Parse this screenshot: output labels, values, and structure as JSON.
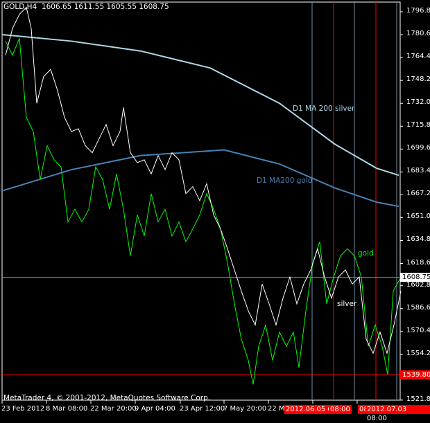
{
  "header": {
    "symbol": "GOLD,H4",
    "open": "1606.65",
    "high": "1611.55",
    "low": "1605.55",
    "close": "1608.75"
  },
  "copyright": "MetaTrader 4, © 2001-2012, MetaQuotes Software Corp.",
  "price_axis": [
    "1796.80",
    "1780.60",
    "1764.40",
    "1748.20",
    "1732.00",
    "1715.80",
    "1699.60",
    "1683.40",
    "1667.20",
    "1651.00",
    "1634.80",
    "1618.60",
    "1602.85",
    "1586.65",
    "1570.45",
    "1554.25",
    "1538.05",
    "1521.85"
  ],
  "price_tags": {
    "current": "1608.75",
    "line": "1539.80"
  },
  "date_axis": [
    "23 Feb 2012",
    "8 Mar 08:00",
    "22 Mar 20:00",
    "9 Apr 04:00",
    "23 Apr 12:00",
    "7 May 20:00",
    "22 Ma"
  ],
  "vline_labels": [
    "2012.06.05 08:00",
    "08:00",
    "08",
    "2012.07.03 08:00"
  ],
  "annotations": {
    "ma_silver": "D1 MA 200 silver",
    "ma_gold": "D1 MA200 gold",
    "gold": "gold",
    "silver": "silver"
  },
  "colors": {
    "silver": "#ffffff",
    "gold": "#00ff00",
    "ma_silver": "#add8e6",
    "ma_gold": "#4682b4",
    "red": "#ff0000",
    "grid": "#6f8fa8"
  },
  "chart_data": {
    "type": "line",
    "ylim": [
      1521.85,
      1796.8
    ],
    "silver": [
      [
        0.5,
        1766
      ],
      [
        1.5,
        1785
      ],
      [
        2.5,
        1795
      ],
      [
        3.5,
        1800
      ],
      [
        4.2,
        1785
      ],
      [
        5,
        1732
      ],
      [
        6,
        1751
      ],
      [
        7,
        1756
      ],
      [
        8,
        1741
      ],
      [
        9,
        1722
      ],
      [
        10,
        1712
      ],
      [
        11,
        1714
      ],
      [
        12,
        1702
      ],
      [
        13,
        1697
      ],
      [
        14,
        1707
      ],
      [
        15,
        1717
      ],
      [
        16,
        1702
      ],
      [
        17,
        1712
      ],
      [
        17.5,
        1729
      ],
      [
        18.5,
        1697
      ],
      [
        19.5,
        1690
      ],
      [
        20.5,
        1692
      ],
      [
        21.5,
        1682
      ],
      [
        22.5,
        1695
      ],
      [
        23.5,
        1685
      ],
      [
        24.5,
        1697
      ],
      [
        25.5,
        1692
      ],
      [
        26.5,
        1668
      ],
      [
        27.5,
        1673
      ],
      [
        28.5,
        1663
      ],
      [
        29.5,
        1675
      ],
      [
        30.5,
        1653
      ],
      [
        31.5,
        1643
      ],
      [
        32.5,
        1629
      ],
      [
        33.5,
        1614
      ],
      [
        34.5,
        1599
      ],
      [
        35.5,
        1585
      ],
      [
        36.5,
        1575
      ],
      [
        37.5,
        1604
      ],
      [
        38.5,
        1590
      ],
      [
        39.5,
        1575
      ],
      [
        40.5,
        1594
      ],
      [
        41.5,
        1609
      ],
      [
        42.5,
        1590
      ],
      [
        43.5,
        1604
      ],
      [
        44.5,
        1614
      ],
      [
        45.5,
        1629
      ],
      [
        46.5,
        1609
      ],
      [
        47.5,
        1594
      ],
      [
        48.5,
        1609
      ],
      [
        49.5,
        1614
      ],
      [
        50.5,
        1604
      ],
      [
        51.5,
        1609
      ],
      [
        52.5,
        1565
      ],
      [
        53.5,
        1555
      ],
      [
        54.5,
        1570
      ],
      [
        55.5,
        1555
      ],
      [
        56.5,
        1575
      ],
      [
        57.5,
        1599
      ]
    ],
    "gold": [
      [
        0.5,
        1776
      ],
      [
        1.5,
        1766
      ],
      [
        2.5,
        1778
      ],
      [
        3.5,
        1722
      ],
      [
        4.5,
        1712
      ],
      [
        5.5,
        1678
      ],
      [
        6.5,
        1702
      ],
      [
        7.5,
        1692
      ],
      [
        8.5,
        1687
      ],
      [
        9.5,
        1648
      ],
      [
        10.5,
        1657
      ],
      [
        11.5,
        1648
      ],
      [
        12.5,
        1657
      ],
      [
        13.5,
        1687
      ],
      [
        14.5,
        1678
      ],
      [
        15.5,
        1657
      ],
      [
        16.5,
        1682
      ],
      [
        17.5,
        1657
      ],
      [
        18.5,
        1624
      ],
      [
        19.5,
        1653
      ],
      [
        20.5,
        1638
      ],
      [
        21.5,
        1668
      ],
      [
        22.5,
        1648
      ],
      [
        23.5,
        1657
      ],
      [
        24.5,
        1638
      ],
      [
        25.5,
        1648
      ],
      [
        26.5,
        1634
      ],
      [
        27.5,
        1643
      ],
      [
        28.5,
        1653
      ],
      [
        29.5,
        1668
      ],
      [
        30.5,
        1657
      ],
      [
        31.5,
        1643
      ],
      [
        32.5,
        1619
      ],
      [
        33.5,
        1590
      ],
      [
        34.5,
        1565
      ],
      [
        35.5,
        1550
      ],
      [
        36.2,
        1533
      ],
      [
        37,
        1560
      ],
      [
        38,
        1575
      ],
      [
        39,
        1550
      ],
      [
        40,
        1570
      ],
      [
        41,
        1560
      ],
      [
        42,
        1570
      ],
      [
        42.8,
        1545
      ],
      [
        43.8,
        1585
      ],
      [
        44.8,
        1619
      ],
      [
        45.8,
        1634
      ],
      [
        46.8,
        1590
      ],
      [
        47.8,
        1609
      ],
      [
        48.8,
        1624
      ],
      [
        49.8,
        1629
      ],
      [
        50.8,
        1624
      ],
      [
        51.8,
        1609
      ],
      [
        52.8,
        1560
      ],
      [
        53.8,
        1575
      ],
      [
        54.8,
        1560
      ],
      [
        55.6,
        1540
      ],
      [
        56.4,
        1599
      ],
      [
        57.5,
        1609
      ]
    ],
    "ma_silver": [
      [
        0,
        1780.6
      ],
      [
        10,
        1776
      ],
      [
        20,
        1769
      ],
      [
        30,
        1757
      ],
      [
        40,
        1732
      ],
      [
        48,
        1703
      ],
      [
        54,
        1686
      ],
      [
        57.2,
        1681
      ]
    ],
    "ma_gold": [
      [
        0,
        1670
      ],
      [
        10,
        1685
      ],
      [
        20,
        1695
      ],
      [
        32,
        1699
      ],
      [
        40,
        1689
      ],
      [
        48,
        1672
      ],
      [
        54,
        1662
      ],
      [
        57.2,
        1659
      ]
    ],
    "hlines": {
      "current": 1608.75,
      "red": 1539.8
    },
    "vlines_gray": [
      44.7,
      50.8,
      56.9
    ],
    "vlines_red": [
      47.8,
      53.9
    ]
  }
}
